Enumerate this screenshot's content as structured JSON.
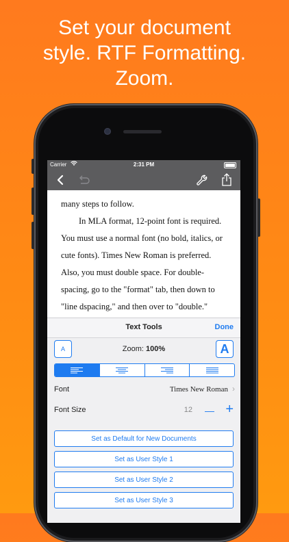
{
  "headline": [
    "Set your document",
    "style. RTF Formatting.",
    "Zoom."
  ],
  "status": {
    "carrier": "Carrier",
    "time": "2:31 PM"
  },
  "navbar": {
    "back_icon": "chevron-left-icon",
    "undo_icon": "undo-icon",
    "tools_icon": "wrench-icon",
    "share_icon": "share-icon"
  },
  "document": {
    "lines": [
      "many steps to follow.",
      "In MLA format, 12-point font is required.",
      "You must use a normal font (no bold, italics, or",
      "cute fonts). Times New Roman is preferred.",
      "Also, you must double space. For double-",
      "spacing, go to the \"format\" tab, then down to",
      "\"line dspacing,\" and then over to \"double.\""
    ]
  },
  "text_tools": {
    "title": "Text Tools",
    "done": "Done",
    "zoom_small": "A",
    "zoom_label": "Zoom:",
    "zoom_value": "100%",
    "zoom_large": "A",
    "alignment_selected": "left",
    "font_label": "Font",
    "font_value": "Times New Roman",
    "font_size_label": "Font Size",
    "font_size_value": "12",
    "minus": "—",
    "plus": "+",
    "actions": [
      "Set as Default for New Documents",
      "Set as User Style 1",
      "Set as User Style 2",
      "Set as User Style 3"
    ]
  },
  "colors": {
    "accent": "#1e7bf0",
    "background": "#ff8a14",
    "toolbar": "#5c5c5e"
  }
}
